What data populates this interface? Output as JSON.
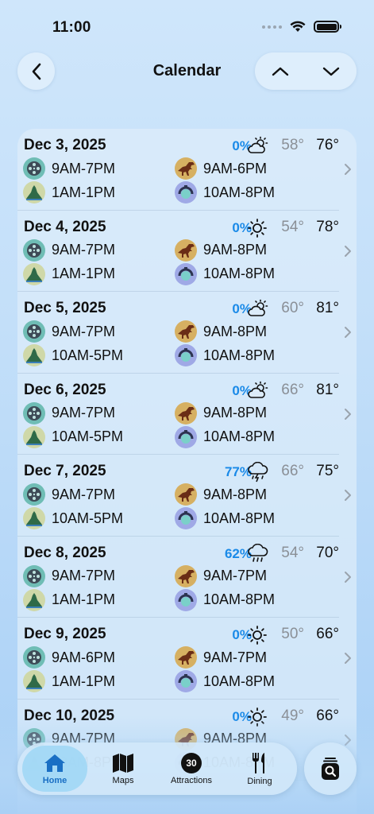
{
  "status": {
    "time": "11:00"
  },
  "header": {
    "title": "Calendar"
  },
  "days": [
    {
      "date": "Dec 3, 2025",
      "precip": "0%",
      "weather": "partly-cloudy",
      "low": "58°",
      "high": "76°",
      "parks": [
        {
          "hours": "9AM-7PM"
        },
        {
          "hours": "9AM-6PM"
        },
        {
          "hours": "1AM-1PM"
        },
        {
          "hours": "10AM-8PM"
        }
      ]
    },
    {
      "date": "Dec 4, 2025",
      "precip": "0%",
      "weather": "sunny",
      "low": "54°",
      "high": "78°",
      "parks": [
        {
          "hours": "9AM-7PM"
        },
        {
          "hours": "9AM-8PM"
        },
        {
          "hours": "1AM-1PM"
        },
        {
          "hours": "10AM-8PM"
        }
      ]
    },
    {
      "date": "Dec 5, 2025",
      "precip": "0%",
      "weather": "partly-cloudy",
      "low": "60°",
      "high": "81°",
      "parks": [
        {
          "hours": "9AM-7PM"
        },
        {
          "hours": "9AM-8PM"
        },
        {
          "hours": "10AM-5PM"
        },
        {
          "hours": "10AM-8PM"
        }
      ]
    },
    {
      "date": "Dec 6, 2025",
      "precip": "0%",
      "weather": "partly-cloudy",
      "low": "66°",
      "high": "81°",
      "parks": [
        {
          "hours": "9AM-7PM"
        },
        {
          "hours": "9AM-8PM"
        },
        {
          "hours": "10AM-5PM"
        },
        {
          "hours": "10AM-8PM"
        }
      ]
    },
    {
      "date": "Dec 7, 2025",
      "precip": "77%",
      "weather": "thunderstorm",
      "low": "66°",
      "high": "75°",
      "parks": [
        {
          "hours": "9AM-7PM"
        },
        {
          "hours": "9AM-8PM"
        },
        {
          "hours": "10AM-5PM"
        },
        {
          "hours": "10AM-8PM"
        }
      ]
    },
    {
      "date": "Dec 8, 2025",
      "precip": "62%",
      "weather": "rain",
      "low": "54°",
      "high": "70°",
      "parks": [
        {
          "hours": "9AM-7PM"
        },
        {
          "hours": "9AM-7PM"
        },
        {
          "hours": "1AM-1PM"
        },
        {
          "hours": "10AM-8PM"
        }
      ]
    },
    {
      "date": "Dec 9, 2025",
      "precip": "0%",
      "weather": "sunny",
      "low": "50°",
      "high": "66°",
      "parks": [
        {
          "hours": "9AM-6PM"
        },
        {
          "hours": "9AM-7PM"
        },
        {
          "hours": "1AM-1PM"
        },
        {
          "hours": "10AM-8PM"
        }
      ]
    },
    {
      "date": "Dec 10, 2025",
      "precip": "0%",
      "weather": "sunny",
      "low": "49°",
      "high": "66°",
      "parks": [
        {
          "hours": "9AM-7PM"
        },
        {
          "hours": "9AM-8PM"
        },
        {
          "hours": "10AM-8PM"
        },
        {
          "hours": "10AM-8PM"
        }
      ]
    }
  ],
  "tabs": [
    {
      "label": "Home",
      "icon": "house-icon",
      "active": true
    },
    {
      "label": "Maps",
      "icon": "map-icon"
    },
    {
      "label": "Attractions",
      "icon": "attractions-count-icon",
      "badge": "30"
    },
    {
      "label": "Dining",
      "icon": "fork-knife-icon"
    }
  ],
  "colors": {
    "accent": "#1a8ae8",
    "tab_active": "#1a6fc4"
  }
}
